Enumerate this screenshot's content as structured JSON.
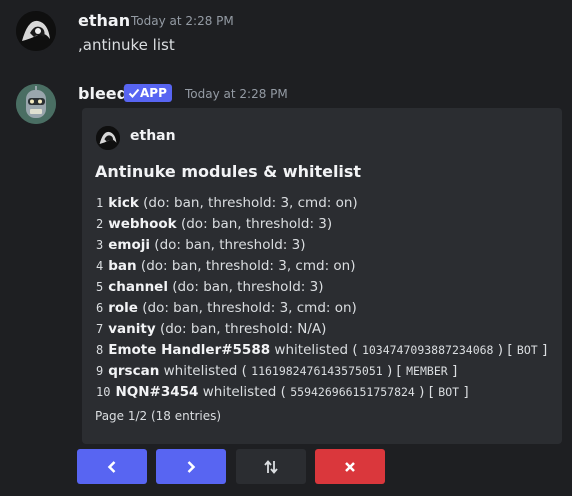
{
  "message1": {
    "username": "ethan",
    "timestamp": "Today at 2:28 PM",
    "content": ",antinuke list"
  },
  "message2": {
    "username": "bleed",
    "badge": "APP",
    "timestamp": "Today at 2:28 PM"
  },
  "embed": {
    "author": "ethan",
    "title": "Antinuke modules & whitelist",
    "modules": [
      {
        "num": "1",
        "name": "kick",
        "detail": "(do: ban, threshold: 3, cmd: on)"
      },
      {
        "num": "2",
        "name": "webhook",
        "detail": "(do: ban, threshold: 3)"
      },
      {
        "num": "3",
        "name": "emoji",
        "detail": "(do: ban, threshold: 3)"
      },
      {
        "num": "4",
        "name": "ban",
        "detail": "(do: ban, threshold: 3, cmd: on)"
      },
      {
        "num": "5",
        "name": "channel",
        "detail": "(do: ban, threshold: 3)"
      },
      {
        "num": "6",
        "name": "role",
        "detail": "(do: ban, threshold: 3, cmd: on)"
      },
      {
        "num": "7",
        "name": "vanity",
        "detail": "(do: ban, threshold: N/A)"
      }
    ],
    "whitelist": [
      {
        "num": "8",
        "name": "Emote Handler#5588",
        "text": "whitelisted",
        "id": "1034747093887234068",
        "tag": "BOT"
      },
      {
        "num": "9",
        "name": "qrscan",
        "text": "whitelisted",
        "id": "1161982476143575051",
        "tag": "MEMBER"
      },
      {
        "num": "10",
        "name": "NQN#3454",
        "text": "whitelisted",
        "id": "559426966151757824",
        "tag": "BOT"
      }
    ],
    "footer": "Page 1/2 (18 entries)"
  },
  "colors": {
    "blurple": "#5865f2",
    "neutral": "#2b2d31",
    "danger": "#da373c"
  },
  "buttons": {
    "prev_icon": "chevron-left-icon",
    "next_icon": "chevron-right-icon",
    "navigate_icon": "sort-arrows-icon",
    "cancel_icon": "close-icon"
  }
}
